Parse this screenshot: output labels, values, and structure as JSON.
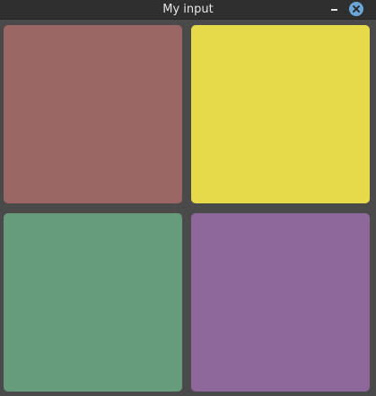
{
  "window": {
    "title": "My input",
    "minimize_icon": "minimize-icon",
    "close_icon": "close-icon",
    "background": "#4a4a4a",
    "titlebar_color": "#2f2f2f",
    "close_button_color": "#6aa6d8"
  },
  "tiles": [
    {
      "color": "#9b6764"
    },
    {
      "color": "#e6d94a"
    },
    {
      "color": "#669b7b"
    },
    {
      "color": "#8e679b"
    }
  ]
}
